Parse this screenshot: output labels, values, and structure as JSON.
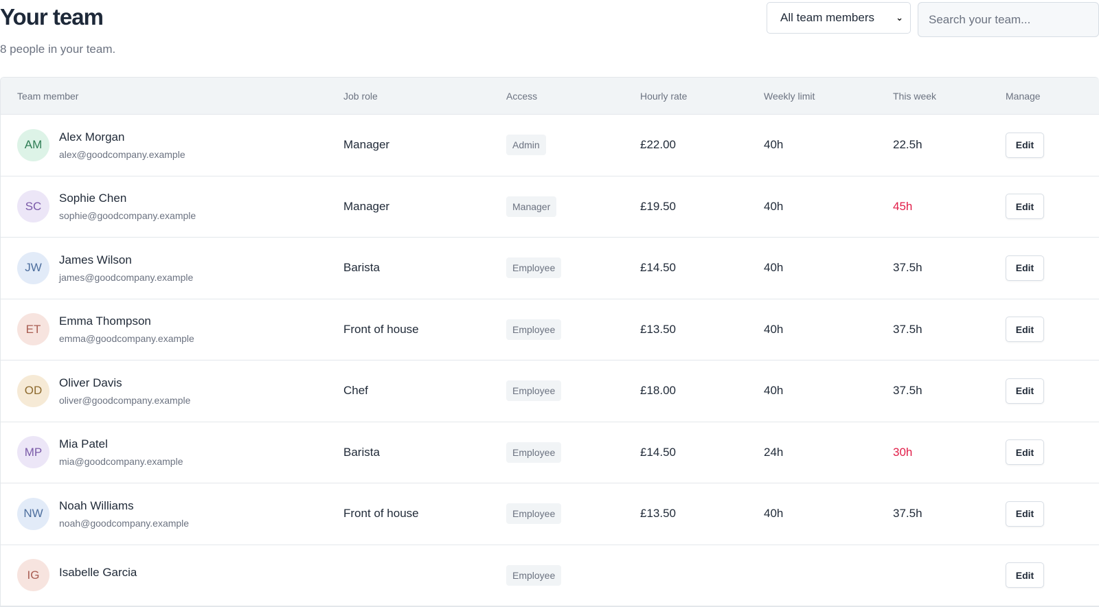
{
  "header": {
    "title": "Your team",
    "subtitle": "8 people in your team.",
    "filter_label": "All team members",
    "search_placeholder": "Search your team..."
  },
  "columns": {
    "member": "Team member",
    "role": "Job role",
    "access": "Access",
    "rate": "Hourly rate",
    "limit": "Weekly limit",
    "week": "This week",
    "manage": "Manage"
  },
  "edit_label": "Edit",
  "members": [
    {
      "initials": "AM",
      "name": "Alex Morgan",
      "email": "alex@goodcompany.example",
      "role": "Manager",
      "access": "Admin",
      "rate": "£22.00",
      "limit": "40h",
      "week": "22.5h",
      "over": false,
      "avatar_bg": "#ddf3e7",
      "avatar_fg": "#2f7d55"
    },
    {
      "initials": "SC",
      "name": "Sophie Chen",
      "email": "sophie@goodcompany.example",
      "role": "Manager",
      "access": "Manager",
      "rate": "£19.50",
      "limit": "40h",
      "week": "45h",
      "over": true,
      "avatar_bg": "#ece6f7",
      "avatar_fg": "#7a5aa8"
    },
    {
      "initials": "JW",
      "name": "James Wilson",
      "email": "james@goodcompany.example",
      "role": "Barista",
      "access": "Employee",
      "rate": "£14.50",
      "limit": "40h",
      "week": "37.5h",
      "over": false,
      "avatar_bg": "#e2ebf8",
      "avatar_fg": "#4e6f9e"
    },
    {
      "initials": "ET",
      "name": "Emma Thompson",
      "email": "emma@goodcompany.example",
      "role": "Front of house",
      "access": "Employee",
      "rate": "£13.50",
      "limit": "40h",
      "week": "37.5h",
      "over": false,
      "avatar_bg": "#f7e4df",
      "avatar_fg": "#a85d52"
    },
    {
      "initials": "OD",
      "name": "Oliver Davis",
      "email": "oliver@goodcompany.example",
      "role": "Chef",
      "access": "Employee",
      "rate": "£18.00",
      "limit": "40h",
      "week": "37.5h",
      "over": false,
      "avatar_bg": "#f6ead6",
      "avatar_fg": "#8d6a2e"
    },
    {
      "initials": "MP",
      "name": "Mia Patel",
      "email": "mia@goodcompany.example",
      "role": "Barista",
      "access": "Employee",
      "rate": "£14.50",
      "limit": "24h",
      "week": "30h",
      "over": true,
      "avatar_bg": "#ece6f7",
      "avatar_fg": "#7a5aa8"
    },
    {
      "initials": "NW",
      "name": "Noah Williams",
      "email": "noah@goodcompany.example",
      "role": "Front of house",
      "access": "Employee",
      "rate": "£13.50",
      "limit": "40h",
      "week": "37.5h",
      "over": false,
      "avatar_bg": "#e2ebf8",
      "avatar_fg": "#4e6f9e"
    },
    {
      "initials": "IG",
      "name": "Isabelle Garcia",
      "email": "",
      "role": "",
      "access": "Employee",
      "rate": "",
      "limit": "",
      "week": "",
      "over": false,
      "avatar_bg": "#f7e4df",
      "avatar_fg": "#a85d52"
    }
  ]
}
